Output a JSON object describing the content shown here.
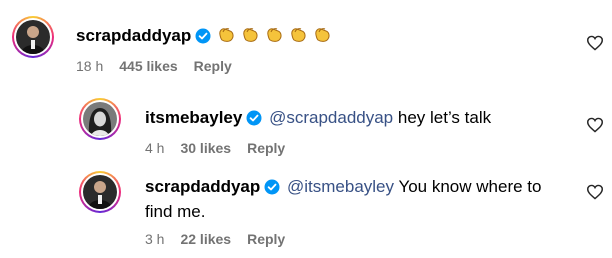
{
  "comments": [
    {
      "username": "scrapdaddyap",
      "mention": "",
      "text": "",
      "emojis": [
        "clapping-hands",
        "clapping-hands",
        "clapping-hands",
        "clapping-hands",
        "clapping-hands"
      ],
      "time": "18 h",
      "likes": "445 likes",
      "reply": "Reply"
    },
    {
      "username": "itsmebayley",
      "mention": "@scrapdaddyap",
      "text": "hey let’s talk",
      "time": "4 h",
      "likes": "30 likes",
      "reply": "Reply"
    },
    {
      "username": "scrapdaddyap",
      "mention": "@itsmebayley",
      "text_line1": "You know where to",
      "text_line2": "find me.",
      "time": "3 h",
      "likes": "22 likes",
      "reply": "Reply"
    }
  ],
  "colors": {
    "verified": "#0095f6",
    "mention": "#385185",
    "meta": "#737373",
    "emoji": "#f5c33b"
  }
}
